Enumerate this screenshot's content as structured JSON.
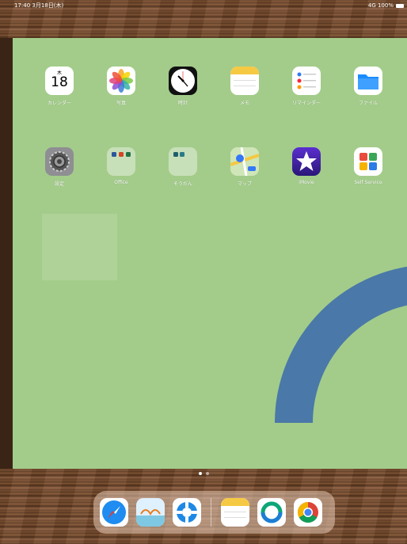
{
  "status_bar": {
    "time_date": "17:40  3月18日(木)",
    "right": "4G 100%"
  },
  "calendar": {
    "weekday": "木",
    "day": "18"
  },
  "apps": [
    {
      "label": "カレンダー",
      "icon": "calendar-icon"
    },
    {
      "label": "写真",
      "icon": "photos-icon"
    },
    {
      "label": "時計",
      "icon": "clock-icon"
    },
    {
      "label": "メモ",
      "icon": "notes-icon"
    },
    {
      "label": "リマインダー",
      "icon": "reminders-icon"
    },
    {
      "label": "ファイル",
      "icon": "files-icon"
    },
    {
      "label": "設定",
      "icon": "settings-icon"
    },
    {
      "label": "Office",
      "icon": "office-folder-icon"
    },
    {
      "label": "そうだん",
      "icon": "soudan-folder-icon"
    },
    {
      "label": "マップ",
      "icon": "maps-icon"
    },
    {
      "label": "iMovie",
      "icon": "imovie-icon"
    },
    {
      "label": "Self Service",
      "icon": "self-service-icon"
    }
  ],
  "dock": [
    {
      "icon": "safari-icon"
    },
    {
      "icon": "school-app-icon"
    },
    {
      "icon": "lifebuoy-icon"
    },
    {
      "icon": "notes-icon"
    },
    {
      "icon": "webex-icon"
    },
    {
      "icon": "chrome-icon"
    }
  ],
  "colors": {
    "wallpaper": "#a3cc8a",
    "arc": "#4a78a8"
  },
  "page_indicator": {
    "pages": 2,
    "current": 1
  }
}
